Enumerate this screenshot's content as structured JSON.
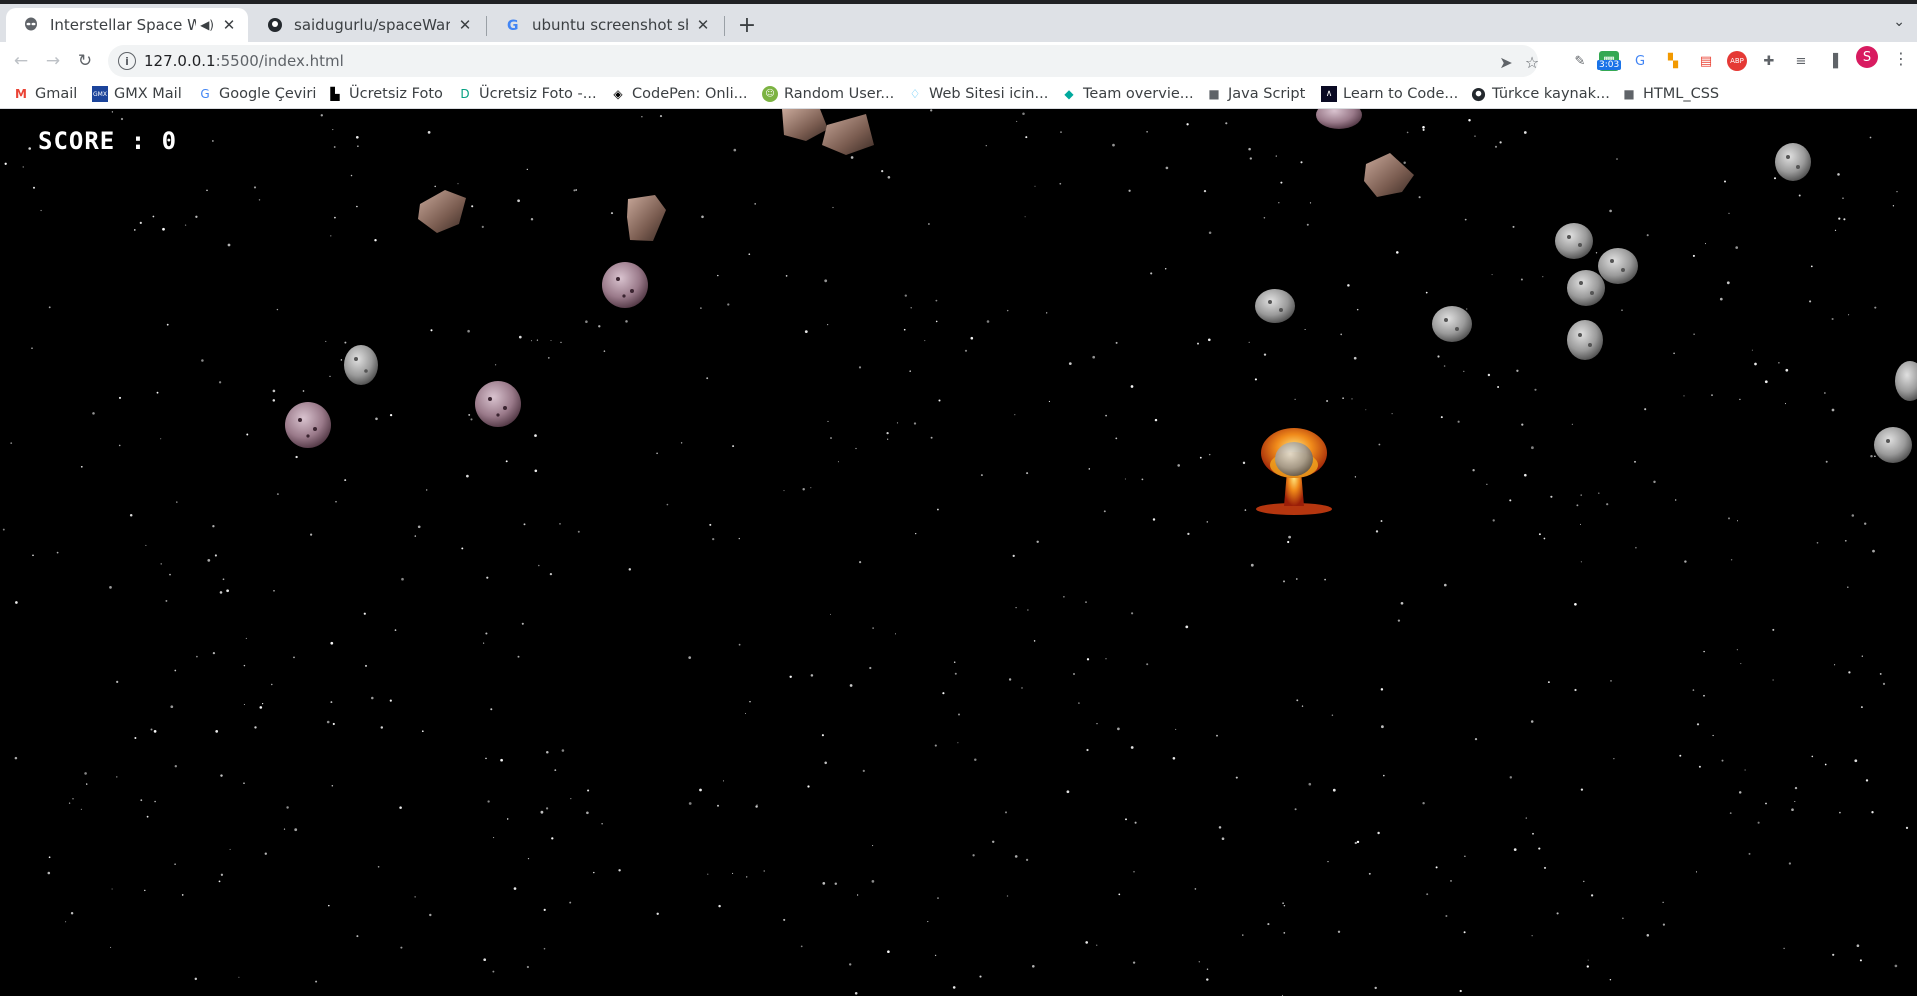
{
  "tabs": [
    {
      "title": "Interstellar Space War",
      "active": true,
      "audio": true,
      "icon": "alien-icon"
    },
    {
      "title": "saidugurlu/spaceWarGam",
      "active": false,
      "icon": "github-icon"
    },
    {
      "title": "ubuntu screenshot shortc",
      "active": false,
      "icon": "google-icon"
    }
  ],
  "toolbar": {
    "url_host": "127.0.0.1",
    "url_path": ":5500/index.html",
    "extension_badge": "3:03",
    "avatar_letter": "S"
  },
  "bookmarks": [
    {
      "label": "Gmail",
      "icon": "gmail-icon"
    },
    {
      "label": "GMX Mail",
      "icon": "gmx-icon"
    },
    {
      "label": "Google Çeviri",
      "icon": "translate-icon"
    },
    {
      "label": "Ücretsiz Foto",
      "icon": "unsplash-icon"
    },
    {
      "label": "Ücretsiz Foto -...",
      "icon": "photo-icon"
    },
    {
      "label": "CodePen: Onli...",
      "icon": "codepen-icon"
    },
    {
      "label": "Random User...",
      "icon": "randomuser-icon"
    },
    {
      "label": "Web Sitesi icin...",
      "icon": "diamond-icon"
    },
    {
      "label": "Team overvie...",
      "icon": "team-icon"
    },
    {
      "label": "Java Script",
      "icon": "folder-icon"
    },
    {
      "label": "Learn to Code...",
      "icon": "freecodecamp-icon"
    },
    {
      "label": "Türkce kaynak...",
      "icon": "github-icon"
    },
    {
      "label": "HTML_CSS",
      "icon": "folder-icon"
    }
  ],
  "game": {
    "score_label": "SCORE : 0",
    "colors": {
      "background": "#000000",
      "score": "#ffffff"
    }
  }
}
